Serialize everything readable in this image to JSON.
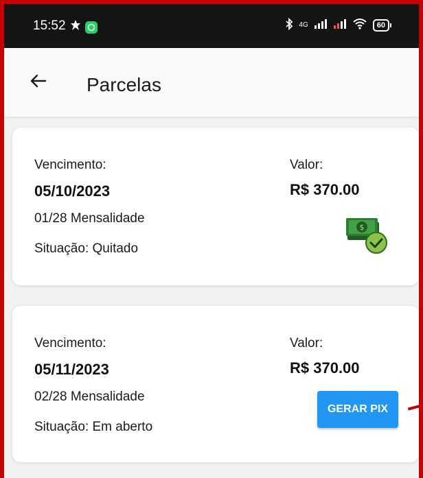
{
  "status_bar": {
    "time": "15:52",
    "network_label": "4G",
    "battery": "60"
  },
  "app_bar": {
    "title": "Parcelas"
  },
  "installments": [
    {
      "due_label": "Vencimento:",
      "due_date": "05/10/2023",
      "description": "01/28 Mensalidade",
      "status": "Situação: Quitado",
      "value_label": "Valor:",
      "value": "R$ 370.00",
      "icon": "paid-money-icon"
    },
    {
      "due_label": "Vencimento:",
      "due_date": "05/11/2023",
      "description": "02/28 Mensalidade",
      "status": "Situação: Em aberto",
      "value_label": "Valor:",
      "value": "R$ 370.00",
      "action_label": "GERAR PIX"
    }
  ],
  "colors": {
    "frame_border": "#c40000",
    "status_bar": "#141414",
    "primary_button": "#2196f3",
    "paid_badge": "#8bc34a",
    "money_green": "#2e7d32"
  }
}
